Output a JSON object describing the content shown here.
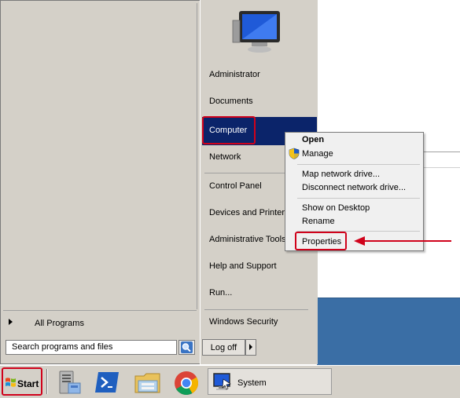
{
  "start_menu": {
    "all_programs_label": "All Programs",
    "search": {
      "placeholder": "Search programs and files",
      "value": "Search programs and files"
    },
    "right_items": [
      "Administrator",
      "Documents",
      "Computer",
      "Network",
      "Control Panel",
      "Devices and Printers",
      "Administrative Tools",
      "Help and Support",
      "Run...",
      "Windows Security"
    ],
    "logoff_label": "Log off"
  },
  "context_menu": {
    "items": [
      {
        "label": "Open",
        "bold": true
      },
      {
        "label": "Manage",
        "icon": "uac-shield-icon"
      },
      {
        "label": "Map network drive..."
      },
      {
        "label": "Disconnect network drive..."
      },
      {
        "label": "Show on Desktop"
      },
      {
        "label": "Rename"
      },
      {
        "label": "Properties"
      }
    ]
  },
  "taskbar": {
    "start_label": "Start",
    "pinned_icons": [
      "server-manager-icon",
      "powershell-icon",
      "file-explorer-icon",
      "chrome-icon"
    ],
    "window_button_label": "System"
  },
  "colors": {
    "highlight": "#0b246a",
    "annotation_red": "#d0021b",
    "desktop_blue": "#3a6ea5",
    "menu_gray": "#d4d0c8"
  }
}
